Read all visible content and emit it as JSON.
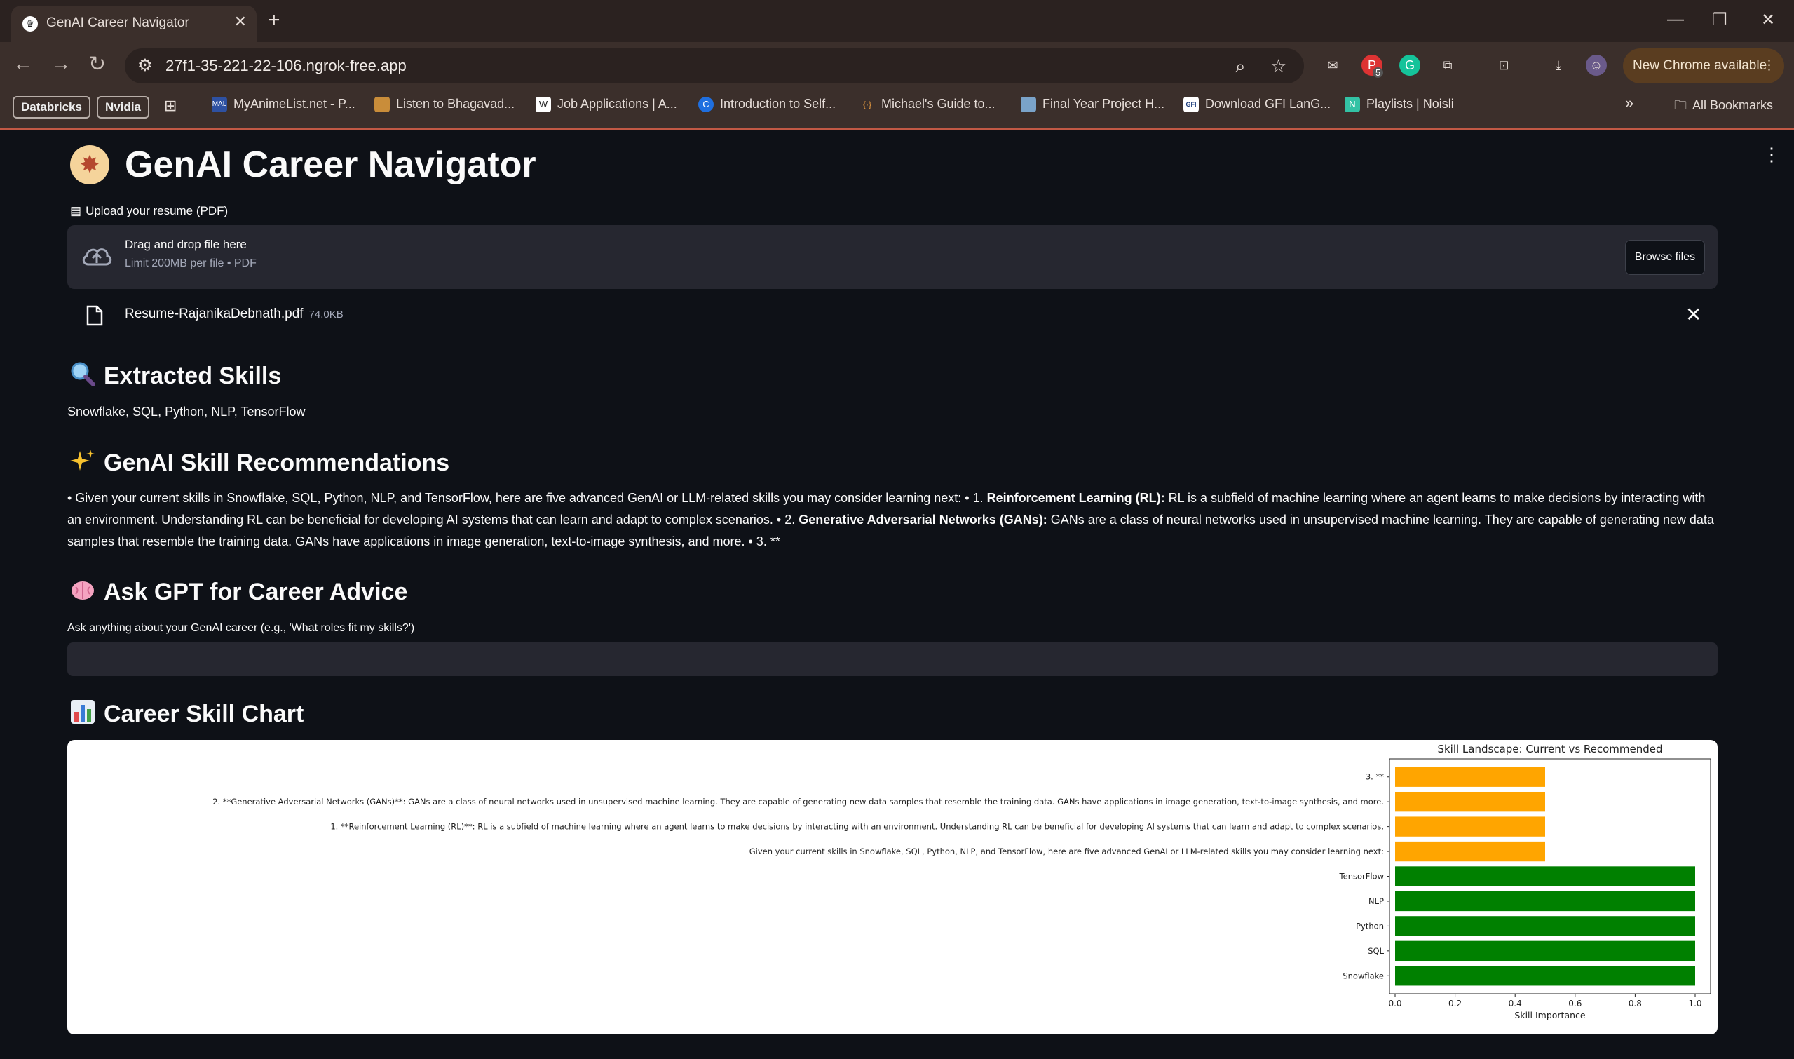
{
  "browser": {
    "tab_title": "GenAI Career Navigator",
    "new_tab": "+",
    "url": "27f1-35-221-22-106.ngrok-free.app",
    "update_label": "New Chrome available",
    "ext_badge": "5",
    "bookmarks_overflow": "»",
    "bookmarks_pills": [
      "Databricks",
      "Nvidia"
    ],
    "bookmarks": [
      {
        "label": "MyAnimeList.net - P...",
        "icon_text": "MAL",
        "color": "#2e51a2"
      },
      {
        "label": "Listen to Bhagavad...",
        "icon_text": "",
        "color": "#c98d3a"
      },
      {
        "label": "Job Applications | A...",
        "icon_text": "W",
        "color": "#ffffff"
      },
      {
        "label": "Introduction to Self...",
        "icon_text": "C",
        "color": "#1f6fe0"
      },
      {
        "label": "Michael's Guide to...",
        "icon_text": "{·}",
        "color": "#3b2f2b"
      },
      {
        "label": "Final Year Project H...",
        "icon_text": "",
        "color": "#7aa3c9"
      },
      {
        "label": "Download GFI LanG...",
        "icon_text": "GFI",
        "color": "#ffffff"
      },
      {
        "label": "Playlists | Noisli",
        "icon_text": "N",
        "color": "#33c2a5"
      }
    ],
    "all_bookmarks": "All Bookmarks"
  },
  "app": {
    "title": "GenAI Career Navigator",
    "upload_label": "Upload your resume (PDF)",
    "dropzone_main": "Drag and drop file here",
    "dropzone_sub": "Limit 200MB per file • PDF",
    "browse_label": "Browse files",
    "file_name": "Resume-RajanikaDebnath.pdf",
    "file_size": "74.0KB",
    "extracted_header": "Extracted Skills",
    "extracted_skills": "Snowflake, SQL, Python, NLP, TensorFlow",
    "reco_header": "GenAI Skill Recommendations",
    "reco_part1": "• Given your current skills in Snowflake, SQL, Python, NLP, and TensorFlow, here are five advanced GenAI or LLM-related skills you may consider learning next: • 1. ",
    "reco_bold1": "Reinforcement Learning (RL):",
    "reco_part2": " RL is a subfield of machine learning where an agent learns to make decisions by interacting with an environment. Understanding RL can be beneficial for developing AI systems that can learn and adapt to complex scenarios. • 2. ",
    "reco_bold2": "Generative Adversarial Networks (GANs):",
    "reco_part3": " GANs are a class of neural networks used in unsupervised machine learning. They are capable of generating new data samples that resemble the training data. GANs have applications in image generation, text-to-image synthesis, and more. • 3. **",
    "ask_header": "Ask GPT for Career Advice",
    "ask_label": "Ask anything about your GenAI career (e.g., 'What roles fit my skills?')",
    "ask_value": "",
    "chart_header": "Career Skill Chart"
  },
  "chart_data": {
    "type": "bar",
    "orientation": "horizontal",
    "title": "Skill Landscape: Current vs Recommended",
    "xlabel": "Skill Importance",
    "ylabel": "",
    "xlim": [
      0,
      1.0
    ],
    "xticks": [
      "0.0",
      "0.2",
      "0.4",
      "0.6",
      "0.8",
      "1.0"
    ],
    "grid": false,
    "categories": [
      "Snowflake",
      "SQL",
      "Python",
      "NLP",
      "TensorFlow",
      "Given your current skills in Snowflake, SQL, Python, NLP, and TensorFlow, here are five advanced GenAI or LLM-related skills you may consider learning next:",
      "1. **Reinforcement Learning (RL)**: RL is a subfield of machine learning where an agent learns to make decisions by interacting with an environment. Understanding RL can be beneficial for developing AI systems that can learn and adapt to complex scenarios.",
      "2. **Generative Adversarial Networks (GANs)**: GANs are a class of neural networks used in unsupervised machine learning. They are capable of generating new data samples that resemble the training data. GANs have applications in image generation, text-to-image synthesis, and more.",
      "3. **"
    ],
    "values": [
      1.0,
      1.0,
      1.0,
      1.0,
      1.0,
      0.5,
      0.5,
      0.5,
      0.5
    ],
    "colors": [
      "#008000",
      "#008000",
      "#008000",
      "#008000",
      "#008000",
      "#ffa500",
      "#ffa500",
      "#ffa500",
      "#ffa500"
    ]
  }
}
